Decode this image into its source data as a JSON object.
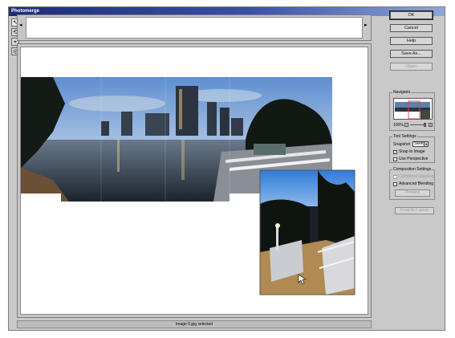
{
  "window": {
    "title": "Photomerge"
  },
  "tools": [
    {
      "name": "select-image-tool",
      "glyph": "↖",
      "active": true
    },
    {
      "name": "rotate-image-tool",
      "glyph": "⟲",
      "active": false
    },
    {
      "name": "set-vanishing-point-tool",
      "glyph": "⌖",
      "active": false
    },
    {
      "name": "zoom-tool",
      "glyph": "◎",
      "active": false
    }
  ],
  "lightbox": {
    "left_arrow": "◂",
    "right_arrow": "▸"
  },
  "buttons": {
    "ok": "OK",
    "cancel": "Cancel",
    "help": "Help",
    "save_as": "Save As...",
    "open": "Open",
    "keep_as_layers": "Keep As Layers"
  },
  "navigator": {
    "title": "Navigator",
    "zoom_percent": "100%",
    "zoom_out_glyph": "-",
    "zoom_in_glyph": "+"
  },
  "tool_settings": {
    "title": "Tool Settings",
    "snapshot_label": "Snapshot",
    "snapshot_value": "Sketch",
    "snap_to_image": "Snap to Image",
    "snap_to_image_checked": true,
    "use_perspective": "Use Perspective",
    "use_perspective_checked": false
  },
  "composition": {
    "title": "Composition Settings",
    "cylindrical_mapping": "Cylindrical Mapping",
    "cylindrical_mapping_checked": false,
    "advanced_blending": "Advanced Blending",
    "advanced_blending_checked": false,
    "preview": "Preview"
  },
  "status": {
    "text": "Image 6.jpg selected"
  },
  "colors": {
    "title_bar": "#1f2a78",
    "sky": "#6f9fd6",
    "water": "#2f3a48",
    "night": "#1d2530"
  }
}
